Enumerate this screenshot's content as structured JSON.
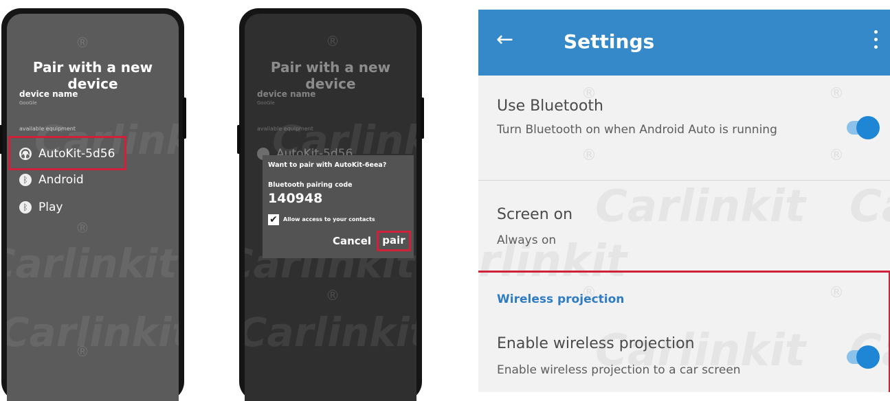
{
  "pair_screen": {
    "title": "Pair with a new device",
    "device_name_label": "device name",
    "device_name_value": "GooGle",
    "available_label": "available equipment",
    "devices": [
      {
        "name": "AutoKit-5d56",
        "icon": "headphones-icon"
      },
      {
        "name": "Android",
        "icon": "bluetooth-icon"
      },
      {
        "name": "Play",
        "icon": "bluetooth-icon"
      }
    ]
  },
  "pair_dialog": {
    "background_title": "Pair with a new device",
    "background_device_label": "device name",
    "background_device_value": "GooGle",
    "background_available_label": "available equipment",
    "background_device": "AutoKit-5d56",
    "title": "Want to pair with AutoKit-6eea?",
    "code_label": "Bluetooth pairing code",
    "code": "140948",
    "allow_contacts": "Allow access to your contacts",
    "allow_checked": true,
    "cancel": "Cancel",
    "pair": "pair"
  },
  "settings": {
    "title": "Settings",
    "back_icon": "arrow-left-icon",
    "more_icon": "more-vert-icon",
    "use_bluetooth": {
      "title": "Use Bluetooth",
      "subtitle": "Turn Bluetooth on when Android Auto is running",
      "enabled": true
    },
    "screen_on": {
      "title": "Screen on",
      "subtitle": "Always on"
    },
    "wireless_section": "Wireless projection",
    "wireless": {
      "title": "Enable wireless projection",
      "subtitle": "Enable wireless projection to a car screen",
      "enabled": true
    }
  },
  "watermark": {
    "text": "Carlinkit",
    "mark": "®"
  },
  "colors": {
    "accent": "#3589c9",
    "highlight": "#d0203a",
    "toggle_on": "#1f86d6"
  }
}
